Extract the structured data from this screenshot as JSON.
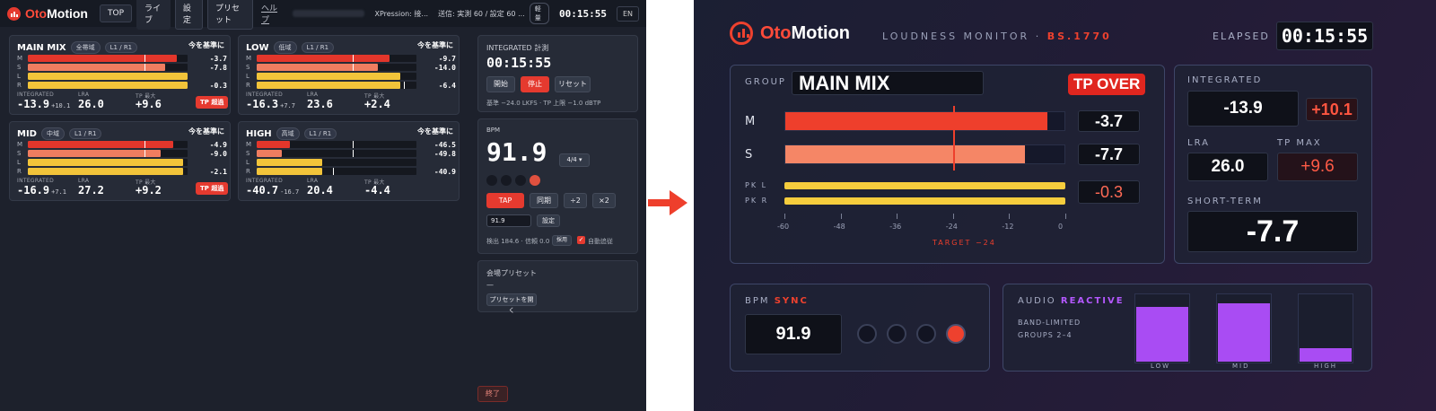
{
  "app": {
    "logo_oto": "Oto",
    "logo_motion": "Motion"
  },
  "topbar": {
    "nav": [
      "TOP",
      "ライブ",
      "設定",
      "プリセット"
    ],
    "help": "ヘルプ",
    "xpression": "XPression: 接...",
    "send": "送信: 実測 60 / 設定 60 ...",
    "badge": "軽量",
    "clock": "00:15:55",
    "lang": "EN"
  },
  "bands": [
    {
      "name": "MAIN MIX",
      "pill": "全帯域",
      "ch": "L1 / R1",
      "ref": "今を基準に",
      "rows": [
        {
          "l": "M",
          "v": "-3.7",
          "fill": 0.93,
          "mark": 0.73,
          "color": "#e3362b"
        },
        {
          "l": "S",
          "v": "-7.8",
          "fill": 0.86,
          "mark": 0.73,
          "color": "#ef7d60"
        },
        {
          "l": "L",
          "v": "",
          "fill": 1.0,
          "mark": null,
          "color": "#f2c43a"
        },
        {
          "l": "R",
          "v": "-0.3",
          "fill": 1.0,
          "mark": null,
          "color": "#f2c43a"
        }
      ],
      "integrated": "-13.9",
      "int_sub": "+10.1",
      "lra": "26.0",
      "tpmax": "+9.6",
      "tp_over": true
    },
    {
      "name": "LOW",
      "pill": "低域",
      "ch": "L1 / R1",
      "ref": "今を基準に",
      "rows": [
        {
          "l": "M",
          "v": "-9.7",
          "fill": 0.83,
          "mark": 0.6,
          "color": "#e3362b"
        },
        {
          "l": "S",
          "v": "-14.0",
          "fill": 0.76,
          "mark": 0.6,
          "color": "#ef7d60"
        },
        {
          "l": "L",
          "v": "",
          "fill": 0.9,
          "mark": null,
          "color": "#f2c43a"
        },
        {
          "l": "R",
          "v": "-6.4",
          "fill": 0.9,
          "mark": 0.92,
          "color": "#f2c43a"
        }
      ],
      "integrated": "-16.3",
      "int_sub": "+7.7",
      "lra": "23.6",
      "tpmax": "+2.4",
      "tp_over": false
    },
    {
      "name": "MID",
      "pill": "中域",
      "ch": "L1 / R1",
      "ref": "今を基準に",
      "rows": [
        {
          "l": "M",
          "v": "-4.9",
          "fill": 0.91,
          "mark": 0.73,
          "color": "#e3362b"
        },
        {
          "l": "S",
          "v": "-9.0",
          "fill": 0.83,
          "mark": 0.73,
          "color": "#ef7d60"
        },
        {
          "l": "L",
          "v": "",
          "fill": 0.97,
          "mark": null,
          "color": "#f2c43a"
        },
        {
          "l": "R",
          "v": "-2.1",
          "fill": 0.97,
          "mark": null,
          "color": "#f2c43a"
        }
      ],
      "integrated": "-16.9",
      "int_sub": "+7.1",
      "lra": "27.2",
      "tpmax": "+9.2",
      "tp_over": true
    },
    {
      "name": "HIGH",
      "pill": "高域",
      "ch": "L1 / R1",
      "ref": "今を基準に",
      "rows": [
        {
          "l": "M",
          "v": "-46.5",
          "fill": 0.21,
          "mark": 0.6,
          "color": "#e3362b"
        },
        {
          "l": "S",
          "v": "-49.8",
          "fill": 0.16,
          "mark": 0.6,
          "color": "#ef7d60"
        },
        {
          "l": "L",
          "v": "",
          "fill": 0.41,
          "mark": null,
          "color": "#f2c43a"
        },
        {
          "l": "R",
          "v": "-40.9",
          "fill": 0.41,
          "mark": 0.48,
          "color": "#f2c43a"
        }
      ],
      "integrated": "-40.7",
      "int_sub": "-16.7",
      "lra": "20.4",
      "tpmax": "-4.4",
      "tp_over": false
    }
  ],
  "labels": {
    "integrated": "INTEGRATED",
    "lra": "LRA",
    "tpmax": "TP 最大",
    "tp_over": "TP 超過"
  },
  "measure": {
    "title": "INTEGRATED 計測",
    "time": "00:15:55",
    "start": "開始",
    "stop": "停止",
    "reset": "リセット",
    "note": "基準 −24.0 LKFS · TP 上限 −1.0 dBTP"
  },
  "bpm": {
    "title": "BPM",
    "value": "91.9",
    "sig": "4/4",
    "tap": "TAP",
    "sync": "同期",
    "half": "÷2",
    "double": "×2",
    "input": "91.9",
    "set": "設定",
    "detect": "検出 184.6 · 信頼 0.0",
    "adopt": "採用",
    "auto": "自動追従"
  },
  "venue": {
    "title": "会場プリセット",
    "value": "—",
    "open": "プリセットを開く"
  },
  "exit": "終了",
  "display": {
    "logo_oto": "Oto",
    "logo_motion": "Motion",
    "subtitle": "LOUDNESS MONITOR · ",
    "subtitle_accent": "BS.1770",
    "elapsed_label": "ELAPSED",
    "elapsed": "00:15:55",
    "group_label": "GROUP",
    "group": "MAIN MIX",
    "tp_over": "TP OVER",
    "m_label": "M",
    "m_value": "-3.7",
    "m_fill": 0.94,
    "s_label": "S",
    "s_value": "-7.7",
    "s_fill": 0.86,
    "pkl": "PK L",
    "pkr": "PK R",
    "pk_value": "-0.3",
    "scale": [
      "-60",
      "-48",
      "-36",
      "-24",
      "-12",
      "0"
    ],
    "target": "TARGET −24",
    "integrated_label": "INTEGRATED",
    "integrated": "-13.9",
    "integrated_delta": "+10.1",
    "lra_label": "LRA",
    "lra": "26.0",
    "tpmax_label": "TP MAX",
    "tpmax": "+9.6",
    "short_label": "SHORT-TERM",
    "short": "-7.7",
    "bpm_label": "BPM",
    "bpm_accent": "SYNC",
    "bpm": "91.9",
    "audio_label": "AUDIO",
    "audio_accent": "REACTIVE",
    "band_note1": "BAND-LIMITED",
    "band_note2": "GROUPS 2–4",
    "vbars": [
      {
        "label": "LOW",
        "level": 0.8
      },
      {
        "label": "MID",
        "level": 0.86
      },
      {
        "label": "HIGH",
        "level": 0.2
      }
    ]
  }
}
